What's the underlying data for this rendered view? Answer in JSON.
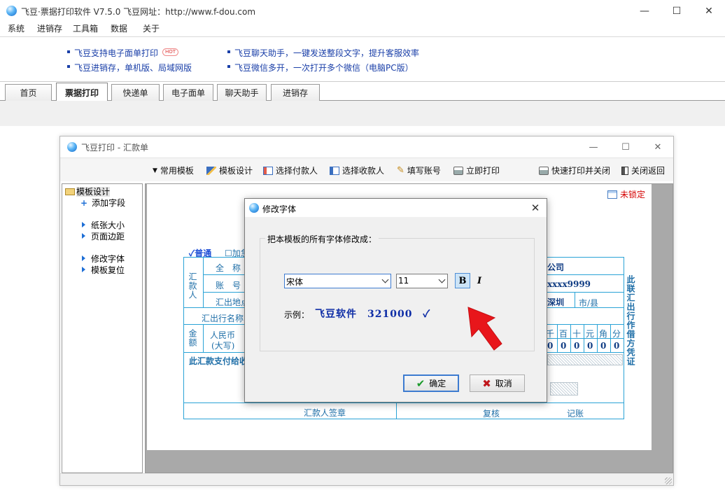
{
  "app": {
    "title": "飞豆·票据打印软件 V7.5.0   飞豆网址：http://www.f-dou.com",
    "window_controls": {
      "minimize": "—",
      "maximize": "☐",
      "close": "✕"
    }
  },
  "menu": [
    "系统",
    "进销存",
    "工具箱",
    "数据",
    "关于"
  ],
  "ads": {
    "left": [
      "飞豆支持电子面单打印",
      "飞豆进销存，单机版、局域网版"
    ],
    "hot": "HOT",
    "right": [
      "飞豆聊天助手，一键发送整段文字，提升客服效率",
      "飞豆微信多开，一次打开多个微信（电脑PC版）"
    ]
  },
  "tabs": [
    {
      "label": "首页",
      "active": false
    },
    {
      "label": "票据打印",
      "active": true
    },
    {
      "label": "快递单",
      "active": false
    },
    {
      "label": "电子面单",
      "active": false
    },
    {
      "label": "聊天助手",
      "active": false
    },
    {
      "label": "进销存",
      "active": false
    }
  ],
  "child_window": {
    "title": "飞豆打印 - 汇款单",
    "toolbar": {
      "common_templates": "常用模板",
      "template_design": "模板设计",
      "select_payer": "选择付款人",
      "select_payee": "选择收款人",
      "fill_account": "填写账号",
      "print_now": "立即打印",
      "quick_print_close": "快速打印并关闭",
      "close_return": "关闭返回"
    },
    "tree": {
      "root": "模板设计",
      "add_field": "添加字段",
      "items": [
        "纸张大小",
        "页面边距",
        "修改字体",
        "模板复位"
      ]
    },
    "lock_status": "未锁定",
    "form": {
      "normal": "普通",
      "urgent_partial": "加急",
      "remitter": "汇款人",
      "full_name": "全　称",
      "account": "账　号",
      "origin": "汇出地点",
      "bank_name": "汇出行名称",
      "amount": "金额",
      "rmb": "人民币",
      "uppercase": "(大写)",
      "pay_to": "此汇款支付给收",
      "company_partial": "公司",
      "account_partial": "xxxx9999",
      "city_partial": "深圳",
      "city_county": "市/县",
      "digit_headers": [
        "千",
        "百",
        "十",
        "元",
        "角",
        "分"
      ],
      "digit_values": [
        "0",
        "0",
        "0",
        "0",
        "0",
        "0"
      ],
      "side_note": "此联汇出行作借方凭证",
      "remitter_sign": "汇款人签章",
      "review": "复核",
      "bookkeeping": "记账"
    }
  },
  "dialog": {
    "title": "修改字体",
    "group_label": "把本模板的所有字体修改成：",
    "font_name": "宋体",
    "font_size": "11",
    "bold_label": "B",
    "italic_label": "I",
    "bold_active": true,
    "sample_label": "示例：",
    "sample_text": "飞豆软件　321000　✓",
    "ok": "确定",
    "cancel": "取消"
  },
  "colors": {
    "accent": "#3d7bd0",
    "form_line": "#2aa3d6",
    "lock_red": "#d40000",
    "arrow_red": "#e8161b"
  }
}
